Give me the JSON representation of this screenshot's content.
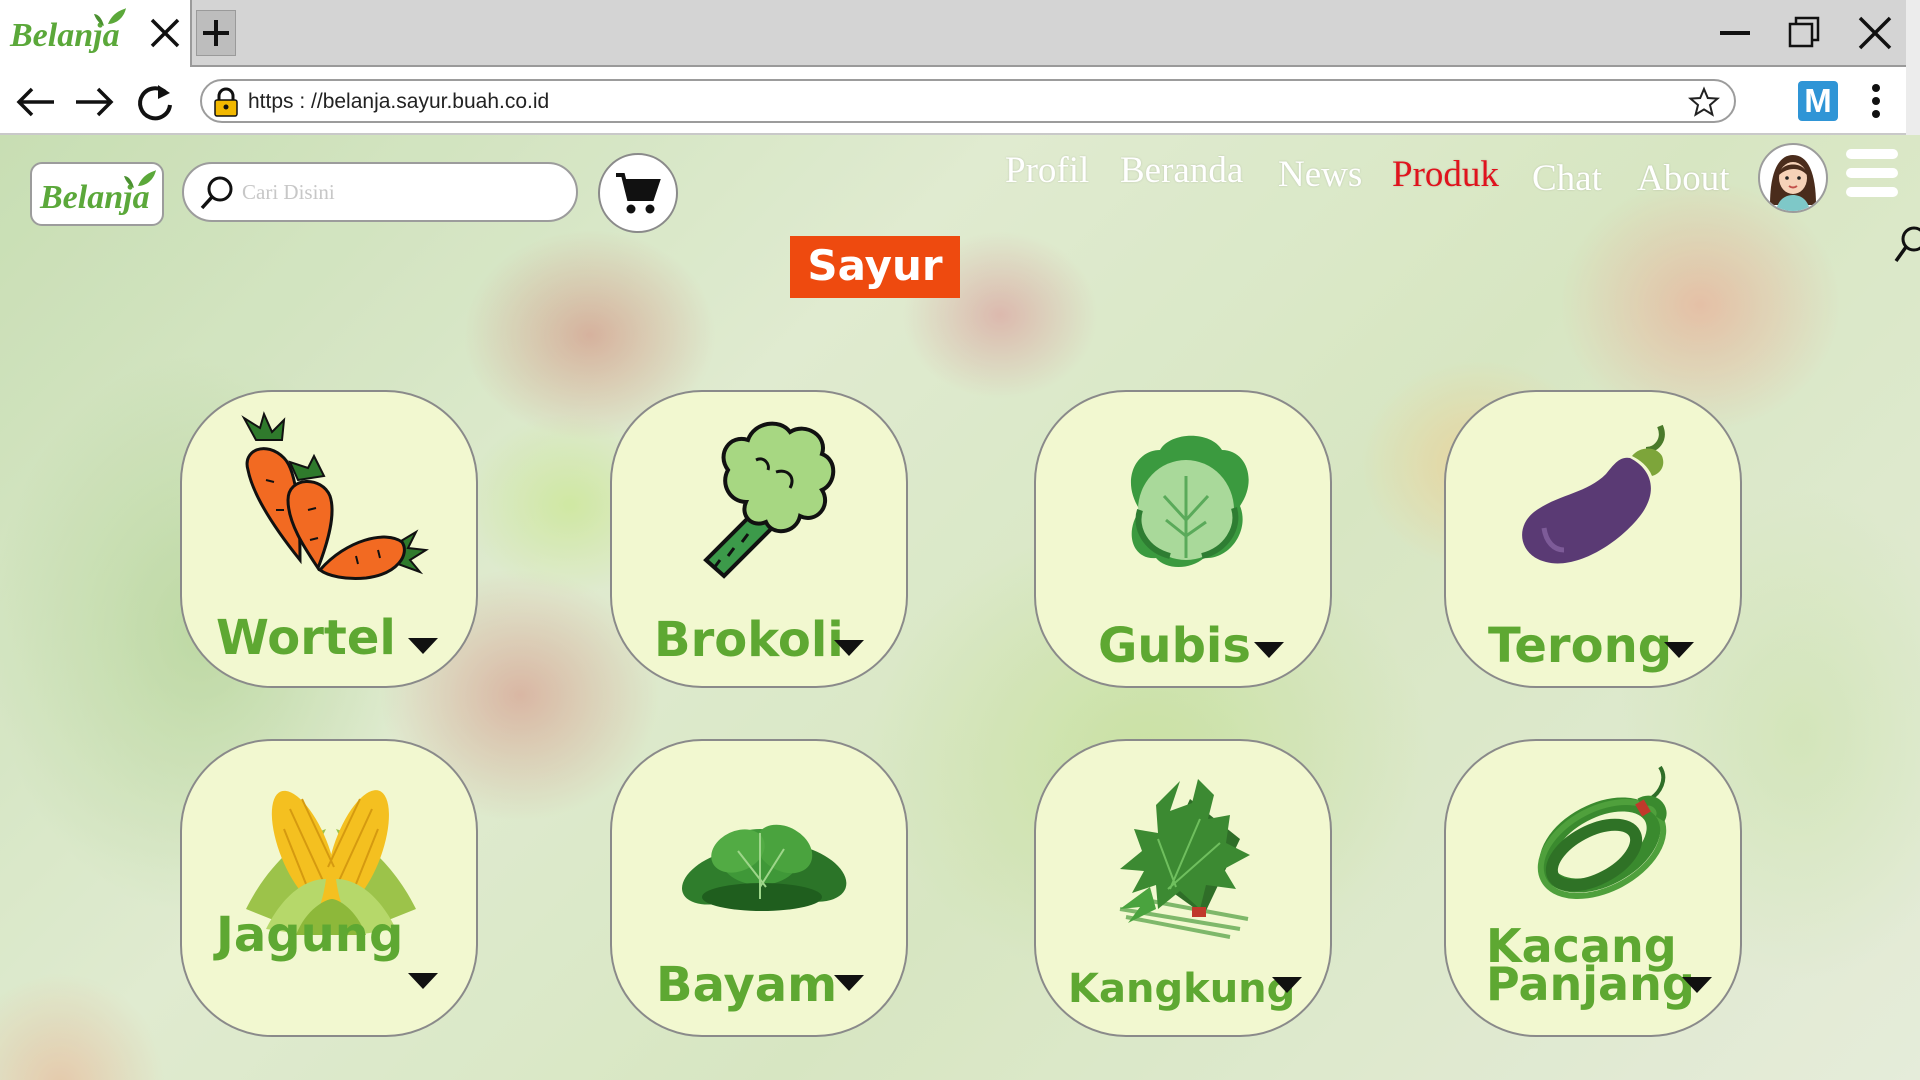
{
  "browser": {
    "tab_logo_text": "Belanja",
    "url": "https : //belanja.sayur.buah.co.id",
    "extension_letter": "M"
  },
  "site": {
    "logo_text": "Belanja",
    "search_placeholder": "Cari Disini",
    "nav": [
      "Profil",
      "Beranda",
      "News",
      "Produk",
      "Chat",
      "About"
    ],
    "active_nav": "Produk",
    "active_color": "#e0131d"
  },
  "section_title": "Sayur",
  "products": [
    {
      "label": "Wortel",
      "icon": "carrot-icon"
    },
    {
      "label": "Brokoli",
      "icon": "broccoli-icon"
    },
    {
      "label": "Gubis",
      "icon": "cabbage-icon"
    },
    {
      "label": "Terong",
      "icon": "eggplant-icon"
    },
    {
      "label": "Jagung",
      "icon": "corn-icon"
    },
    {
      "label": "Bayam",
      "icon": "spinach-icon"
    },
    {
      "label": "Kangkung",
      "icon": "water-spinach-icon"
    },
    {
      "label": "Kacang Panjang",
      "label_lines": [
        "Kacang",
        "Panjang"
      ],
      "icon": "long-bean-icon"
    }
  ],
  "colors": {
    "card_bg": "#f2f8d0",
    "label_green": "#5ea832",
    "title_bg": "#ee4a0f",
    "logo_green": "#5ba83a"
  }
}
